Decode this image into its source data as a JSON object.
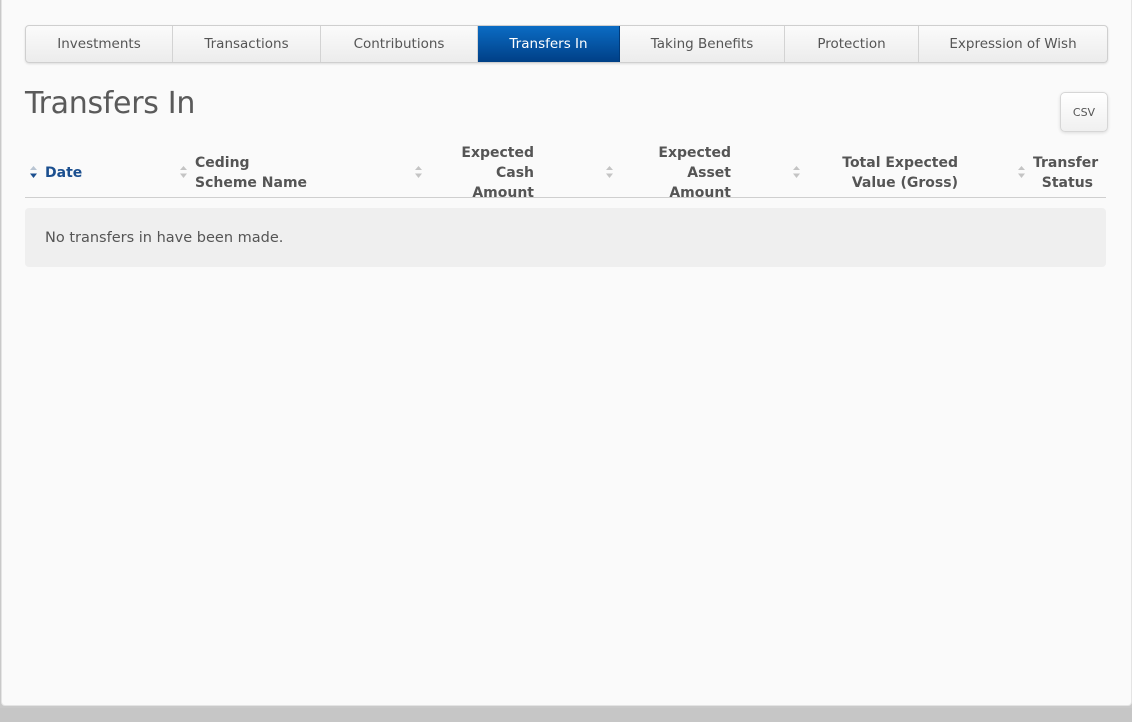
{
  "tabs": [
    {
      "label": "Investments",
      "active": false
    },
    {
      "label": "Transactions",
      "active": false
    },
    {
      "label": "Contributions",
      "active": false
    },
    {
      "label": "Transfers In",
      "active": true
    },
    {
      "label": "Taking Benefits",
      "active": false
    },
    {
      "label": "Protection",
      "active": false
    },
    {
      "label": "Expression of Wish",
      "active": false
    }
  ],
  "page": {
    "title": "Transfers In",
    "csv_label": "CSV"
  },
  "table": {
    "columns": [
      {
        "label": "Date",
        "sorted": "desc"
      },
      {
        "label": "Ceding Scheme Name",
        "sorted": "none"
      },
      {
        "label": "Expected Cash Amount",
        "sorted": "none"
      },
      {
        "label": "Expected Asset Amount",
        "sorted": "none"
      },
      {
        "label": "Total Expected Value (Gross)",
        "sorted": "none"
      },
      {
        "label": "Transfer Status",
        "sorted": "none"
      }
    ],
    "empty_message": "No transfers in have been made."
  },
  "colors": {
    "accent": "#0b5bb0",
    "sorted_text": "#1b4f8f"
  }
}
